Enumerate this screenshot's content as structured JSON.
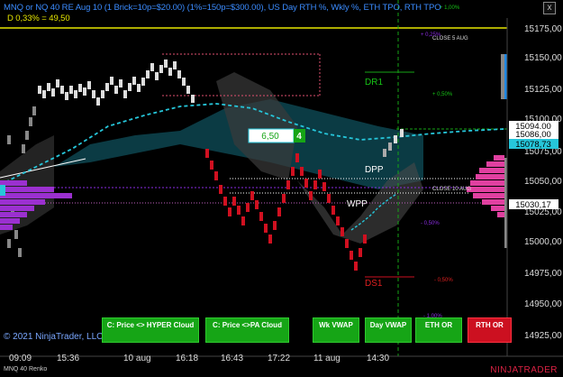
{
  "header": {
    "title_line": "MNQ or NQ 40 RE Aug 10 (1 Brick=10p=$20.00) (1%=150p=$300.00), US Day RTH %, Wkly %, ETH TPO, RTH TPO",
    "stats_line": "D 0,33% = 49,50"
  },
  "window": {
    "close_glyph": "x"
  },
  "price_axis": {
    "ticks": [
      "15175,00",
      "15150,00",
      "15125,00",
      "15100,00",
      "15075,00",
      "15050,00",
      "15025,00",
      "15000,00",
      "14975,00",
      "14950,00",
      "14925,00"
    ],
    "flags": [
      {
        "label": "15094,00",
        "bg": "#ffffff",
        "fg": "#000000"
      },
      {
        "label": "15086,00",
        "bg": "#ffffff",
        "fg": "#000000"
      },
      {
        "label": "15078,73",
        "bg": "#26c6da",
        "fg": "#000000"
      },
      {
        "label": "15030,17",
        "bg": "#ffffff",
        "fg": "#000000"
      }
    ]
  },
  "time_axis": {
    "ticks": [
      "09:09",
      "15:36",
      "10 aug",
      "16:18",
      "16:43",
      "17:22",
      "11 aug",
      "14:30"
    ]
  },
  "levels": {
    "dr1": "DR1",
    "ds1": "DS1",
    "dpp": "DPP",
    "wpp": "WPP",
    "close5": "CLOSE 5 AUG",
    "close10": "CLOSE 10 AUG",
    "pct_top": "+ 1,00%",
    "pct_mid": "+ 0,50%",
    "pct_neg": "- 0,50%",
    "pct_neg2": "- 0,50%",
    "pct_bottom": "- 1,00%",
    "pct_025": "+ 0,25%"
  },
  "box": {
    "value": "6,50",
    "count": "4"
  },
  "footer": {
    "copyright": "© 2021 NinjaTrader, LLC",
    "ticker": "MNQ 40 Renko",
    "brand": "NINJATRADER"
  },
  "buttons": [
    {
      "label": "C: Price <> HYPER Cloud",
      "color": "green"
    },
    {
      "label": "C: Price <>PA Cloud",
      "color": "green"
    },
    {
      "label": "Wk VWAP",
      "color": "green"
    },
    {
      "label": "Day VWAP",
      "color": "green"
    },
    {
      "label": "ETH OR",
      "color": "green"
    },
    {
      "label": "RTH OR",
      "color": "red"
    }
  ],
  "colors": {
    "accent_green": "#16a516",
    "accent_red": "#cc1020",
    "cyan": "#26c6da",
    "magenta": "#e040a0",
    "purple": "#8a2be2"
  }
}
